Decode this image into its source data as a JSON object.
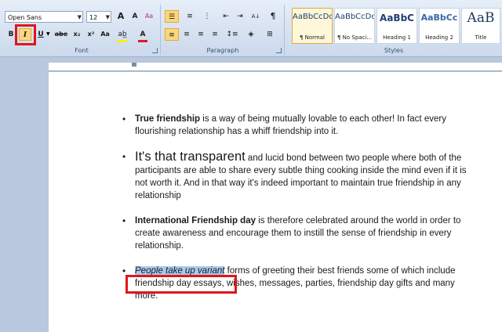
{
  "font": {
    "name": "Open Sans",
    "size": "12",
    "group_label": "Font",
    "buttons": {
      "grow": "A",
      "shrink": "A",
      "clear": "Aa",
      "bold": "B",
      "italic": "I",
      "underline": "U",
      "strike": "abe",
      "subscript": "x₂",
      "superscript": "x²",
      "font_color": "A"
    }
  },
  "paragraph": {
    "group_label": "Paragraph",
    "buttons": {
      "sort": "A↓",
      "pilcrow": "¶"
    }
  },
  "styles": {
    "group_label": "Styles",
    "items": [
      {
        "sample": "AaBbCcDc",
        "name": "¶ Normal"
      },
      {
        "sample": "AaBbCcDc",
        "name": "¶ No Spaci..."
      },
      {
        "sample": "AaBbC",
        "name": "Heading 1"
      },
      {
        "sample": "AaBbCc",
        "name": "Heading 2"
      },
      {
        "sample": "AaB",
        "name": "Title"
      }
    ]
  },
  "document": {
    "items": [
      {
        "lead": "True friendship",
        "rest": " is a way of being mutually lovable to each other! In fact every flourishing relationship has a whiff friendship into it."
      },
      {
        "lead": "It's that transparent",
        "rest": " and lucid bond between two people where both of the participants are able to share every subtle thing cooking inside the mind even if it is not worth it. And in that way it's indeed important to maintain true friendship in any relationship"
      },
      {
        "lead": "International Friendship day",
        "rest": " is therefore celebrated around the world in order to create awareness and encourage them to instill the sense of friendship in every relationship."
      },
      {
        "lead": "People take up variant",
        "rest": " forms of greeting their best friends some of which include friendship day essays, wishes, messages, parties, friendship day gifts and many more."
      }
    ]
  },
  "colors": {
    "highlight_box": "#e0161b",
    "selection": "#a9c9ef",
    "active_button": "#fbd77c"
  }
}
